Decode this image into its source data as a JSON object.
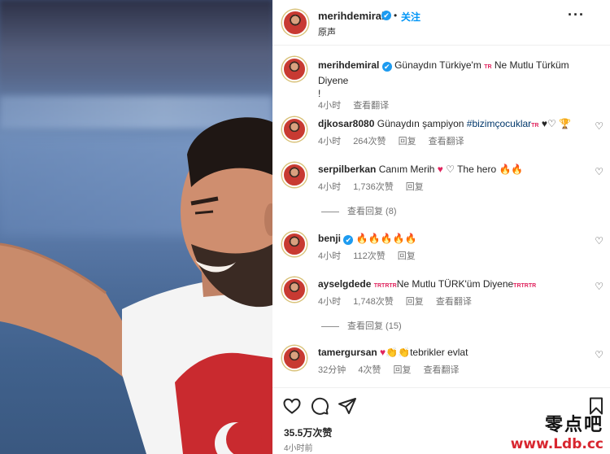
{
  "post": {
    "username": "merihdemiral",
    "verified_glyph": "✔",
    "dot": "•",
    "follow_label": "关注",
    "subtitle": "原声",
    "more_glyph": "···",
    "caption_text": "Günaydın Türkiye'm ",
    "caption_flag": "TR",
    "caption_text2": " Ne Mutlu Türküm Diyene",
    "caption_text3": "!",
    "caption_time": "4小时",
    "caption_translate": "查看翻译"
  },
  "comments": [
    {
      "username": "djkosar8080",
      "text": "Günaydın şampiyon ",
      "hashtag": "#bizimçocuklar",
      "flag": "TR",
      "tail": " ♥♡",
      "trophy": "🏆",
      "time": "4小时",
      "likes": "264次赞",
      "reply": "回复",
      "translate": "查看翻译"
    },
    {
      "username": "serpilberkan",
      "text": "Canım Merih ",
      "heart_red": "♥",
      "heart_white": " ♡ ",
      "text2": "The hero ",
      "fire": "🔥🔥",
      "time": "4小时",
      "likes": "1,736次赞",
      "reply": "回复",
      "view_replies": "查看回复 (8)"
    },
    {
      "username": "benji",
      "fire": "🔥🔥🔥🔥🔥",
      "time": "4小时",
      "likes": "112次赞",
      "reply": "回复"
    },
    {
      "username": "ayselgdede",
      "flags_pre": "TRTRTR",
      "text": "Ne Mutlu TÜRK'üm Diyene",
      "flags_post": "TRTRTR",
      "time": "4小时",
      "likes": "1,748次赞",
      "reply": "回复",
      "translate": "查看翻译",
      "view_replies": "查看回复 (15)"
    },
    {
      "username": "tamergursan",
      "heart_red": "♥",
      "clap": "👏👏",
      "text": "tebrikler evlat",
      "time": "32分钟",
      "likes": "4次赞",
      "reply": "回复",
      "translate": "查看翻译"
    }
  ],
  "comment_like_glyph": "♡",
  "footer": {
    "likes": "35.5万次赞",
    "time": "4小时前"
  },
  "watermark": {
    "text": "零点吧",
    "url": "www.Ldb.cc"
  },
  "icons": [
    "heart-icon",
    "comment-icon",
    "share-icon",
    "bookmark-icon",
    "verified-icon",
    "more-icon"
  ],
  "colors": {
    "accent": "#0095f6",
    "verified": "#1d9bf0",
    "muted": "#737373",
    "watermark_url": "#d8262f"
  }
}
